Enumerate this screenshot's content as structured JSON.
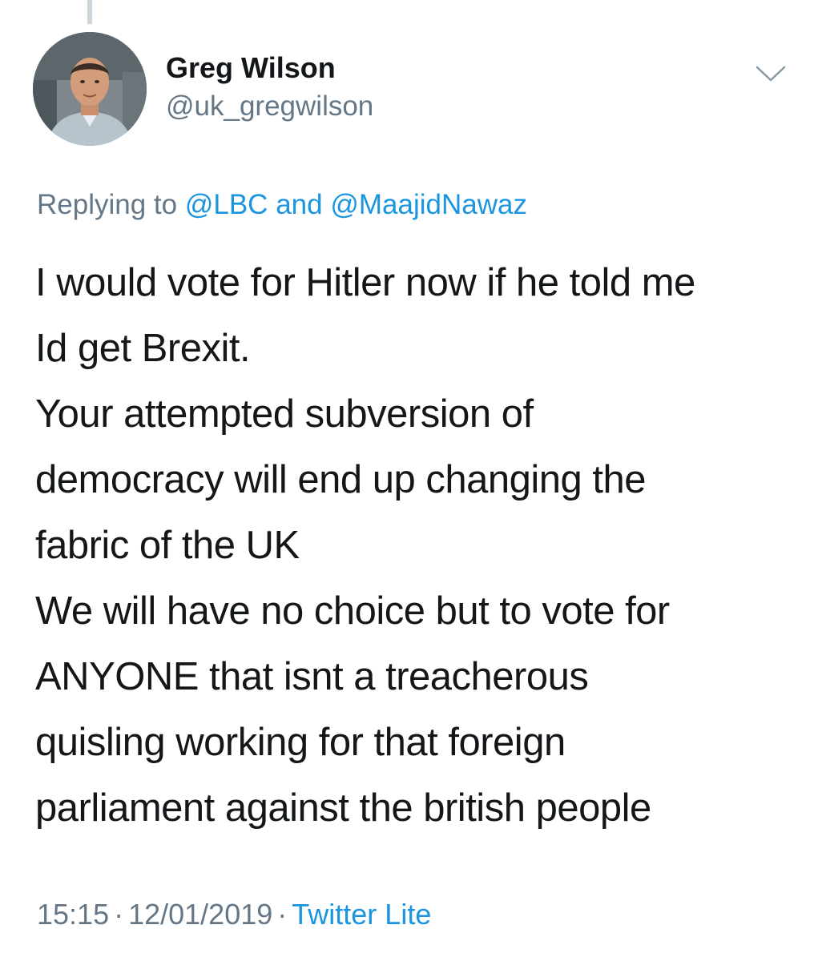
{
  "tweet": {
    "author": {
      "display_name": "Greg Wilson",
      "handle": "@uk_gregwilson"
    },
    "reply": {
      "prefix": "Replying to",
      "mention_1": "@LBC",
      "joiner": "and",
      "mention_2": "@MaajidNawaz"
    },
    "text_lines": [
      "I would vote for Hitler now if he told me",
      "Id get Brexit.",
      "Your attempted subversion of",
      "democracy will end up changing the",
      "fabric of the UK",
      "We will have no choice but to vote for",
      "ANYONE that isnt a treacherous",
      "quisling working for that foreign",
      "parliament against the british people"
    ],
    "meta": {
      "time": "15:15",
      "separator": "·",
      "date": "12/01/2019",
      "source": "Twitter Lite"
    }
  },
  "icons": {
    "menu": "chevron-down-icon",
    "avatar": "user-avatar"
  },
  "colors": {
    "text_primary": "#14171a",
    "text_secondary": "#657786",
    "link": "#1b95e0",
    "thread_line": "#ccd6dd"
  }
}
